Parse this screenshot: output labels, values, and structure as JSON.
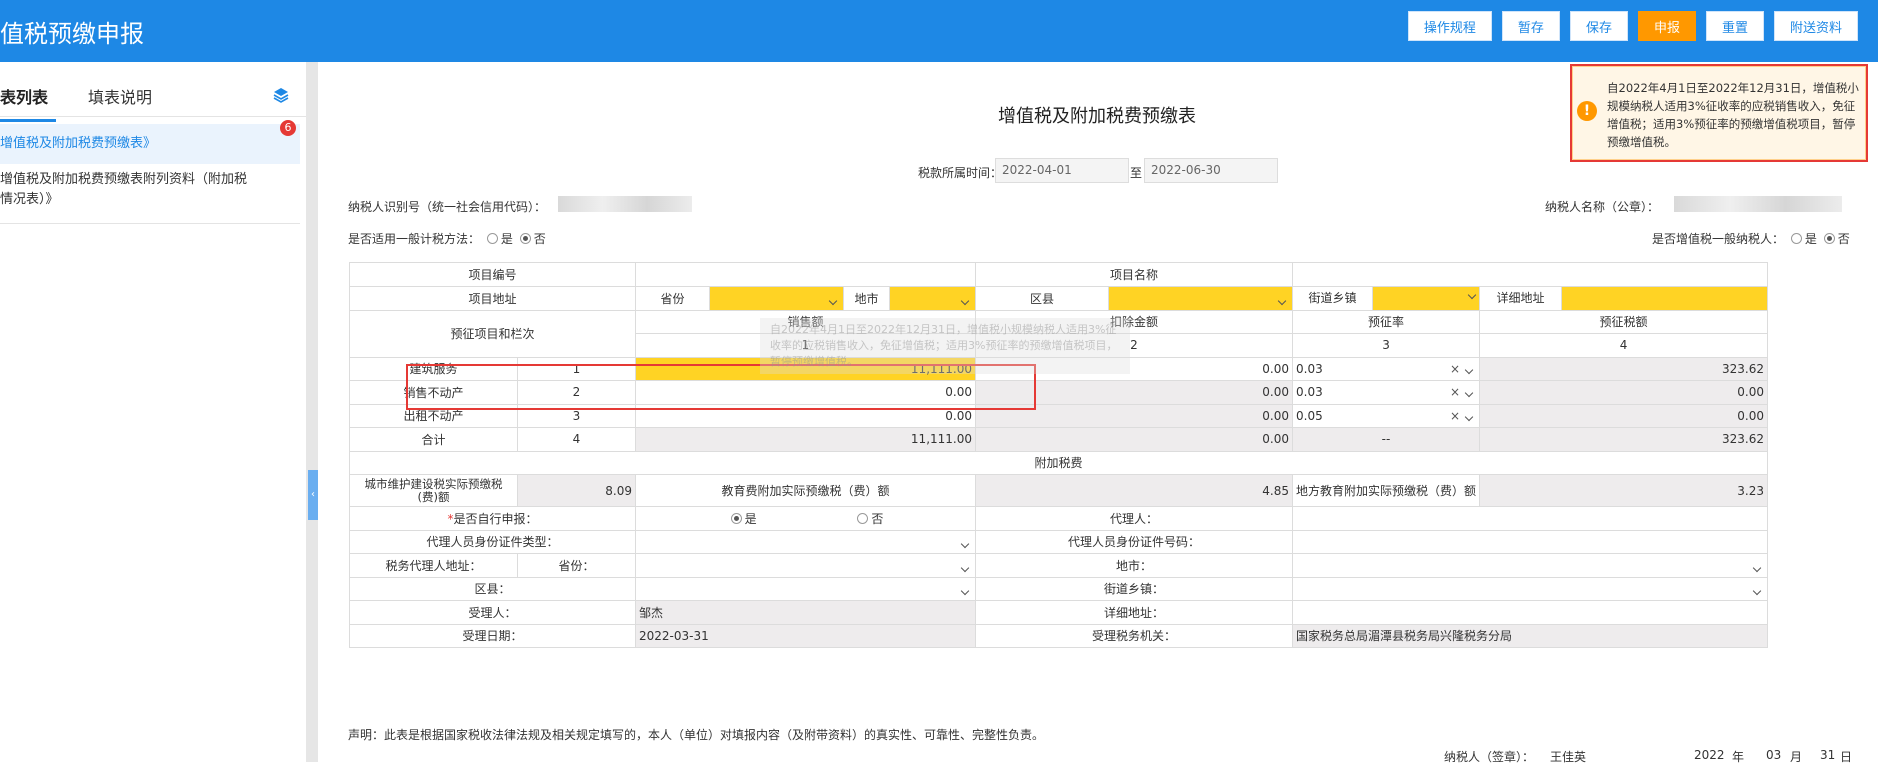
{
  "app": {
    "title": "值税预缴申报"
  },
  "toolbar": {
    "rules": "操作规程",
    "save_temp": "暂存",
    "save": "保存",
    "submit": "申报",
    "reset": "重置",
    "attach": "附送资料"
  },
  "sidebar": {
    "tab_list": "表列表",
    "tab_help": "填表说明",
    "items": [
      {
        "label": "增值税及附加税费预缴表》",
        "badge": "6"
      },
      {
        "label_line1": "增值税及附加税费预缴表附列资料（附加税",
        "label_line2": "情况表）》"
      }
    ]
  },
  "form": {
    "title": "增值税及附加税费预缴表",
    "period_label": "税款所属时间：",
    "period_from": "2022-04-01",
    "period_to_label": "至",
    "period_to": "2022-06-30",
    "taxpayer_id_label": "纳税人识别号（统一社会信用代码）：",
    "taxpayer_name_label": "纳税人名称（公章）：",
    "general_method_label": "是否适用一般计税方法：",
    "general_taxpayer_label": "是否增值税一般纳税人：",
    "yes": "是",
    "no": "否"
  },
  "table": {
    "project_no": "项目编号",
    "project_name": "项目名称",
    "project_addr": "项目地址",
    "province": "省份",
    "city": "地市",
    "district": "区县",
    "street": "街道乡镇",
    "detail_addr": "详细地址",
    "category": "预征项目和栏次",
    "col_sales": "销售额",
    "col_deduct": "扣除金额",
    "col_rate": "预征率",
    "col_tax": "预征税额",
    "colno1": "1",
    "colno2": "2",
    "colno3": "3",
    "colno4": "4",
    "rows": [
      {
        "name": "建筑服务",
        "no": "1",
        "sales": "11,111.00",
        "deduct": "0.00",
        "rate": "0.03",
        "tax": "323.62"
      },
      {
        "name": "销售不动产",
        "no": "2",
        "sales": "0.00",
        "deduct": "0.00",
        "rate": "0.03",
        "tax": "0.00"
      },
      {
        "name": "出租不动产",
        "no": "3",
        "sales": "0.00",
        "deduct": "0.00",
        "rate": "0.05",
        "tax": "0.00"
      },
      {
        "name": "合计",
        "no": "4",
        "sales": "11,111.00",
        "deduct": "0.00",
        "rate": "--",
        "tax": "323.62"
      }
    ],
    "surcharge_title": "附加税费",
    "city_tax_label_1": "城市维护建设税实际预缴税",
    "city_tax_label_2": "(费)额",
    "city_tax": "8.09",
    "edu_label": "教育费附加实际预缴税（费）额",
    "edu": "4.85",
    "local_edu_label": "地方教育附加实际预缴税（费）额",
    "local_edu": "3.23",
    "self_report_label": "是否自行申报：",
    "agent_label": "代理人：",
    "agent_id_type_label": "代理人员身份证件类型：",
    "agent_id_no_label": "代理人员身份证件号码：",
    "agent_addr_label": "税务代理人地址：",
    "province_label": "省份：",
    "city_label": "地市：",
    "district_label": "区县：",
    "street_label": "街道乡镇：",
    "receiver_label": "受理人：",
    "receiver": "邹杰",
    "detail_addr_label": "详细地址：",
    "receive_date_label": "受理日期：",
    "receive_date": "2022-03-31",
    "office_label": "受理税务机关：",
    "office": "国家税务总局湄潭县税务局兴隆税务分局"
  },
  "notice": {
    "text": "自2022年4月1日至2022年12月31日，增值税小规模纳税人适用3%征收率的应税销售收入，免征增值税；适用3%预征率的预缴增值税项目，暂停预缴增值税。"
  },
  "ghost": {
    "text": "自2022年4月1日至2022年12月31日，增值税小规模纳税人适用3%征收率的应税销售收入，免征增值税；适用3%预征率的预缴增值税项目，暂停预缴增值税。"
  },
  "footer": {
    "statement": "声明：此表是根据国家税收法律法规及相关规定填写的，本人（单位）对填报内容（及附带资料）的真实性、可靠性、完整性负责。",
    "sign_label": "纳税人（签章）：",
    "signer": "王佳英",
    "year": "2022",
    "year_unit": "年",
    "month": "03",
    "month_unit": "月",
    "day": "31",
    "day_unit": "日"
  },
  "colors": {
    "header_blue": "#1e88e5",
    "accent_orange": "#ff9800",
    "input_yellow": "#ffd324",
    "alert_red": "#e53935"
  }
}
